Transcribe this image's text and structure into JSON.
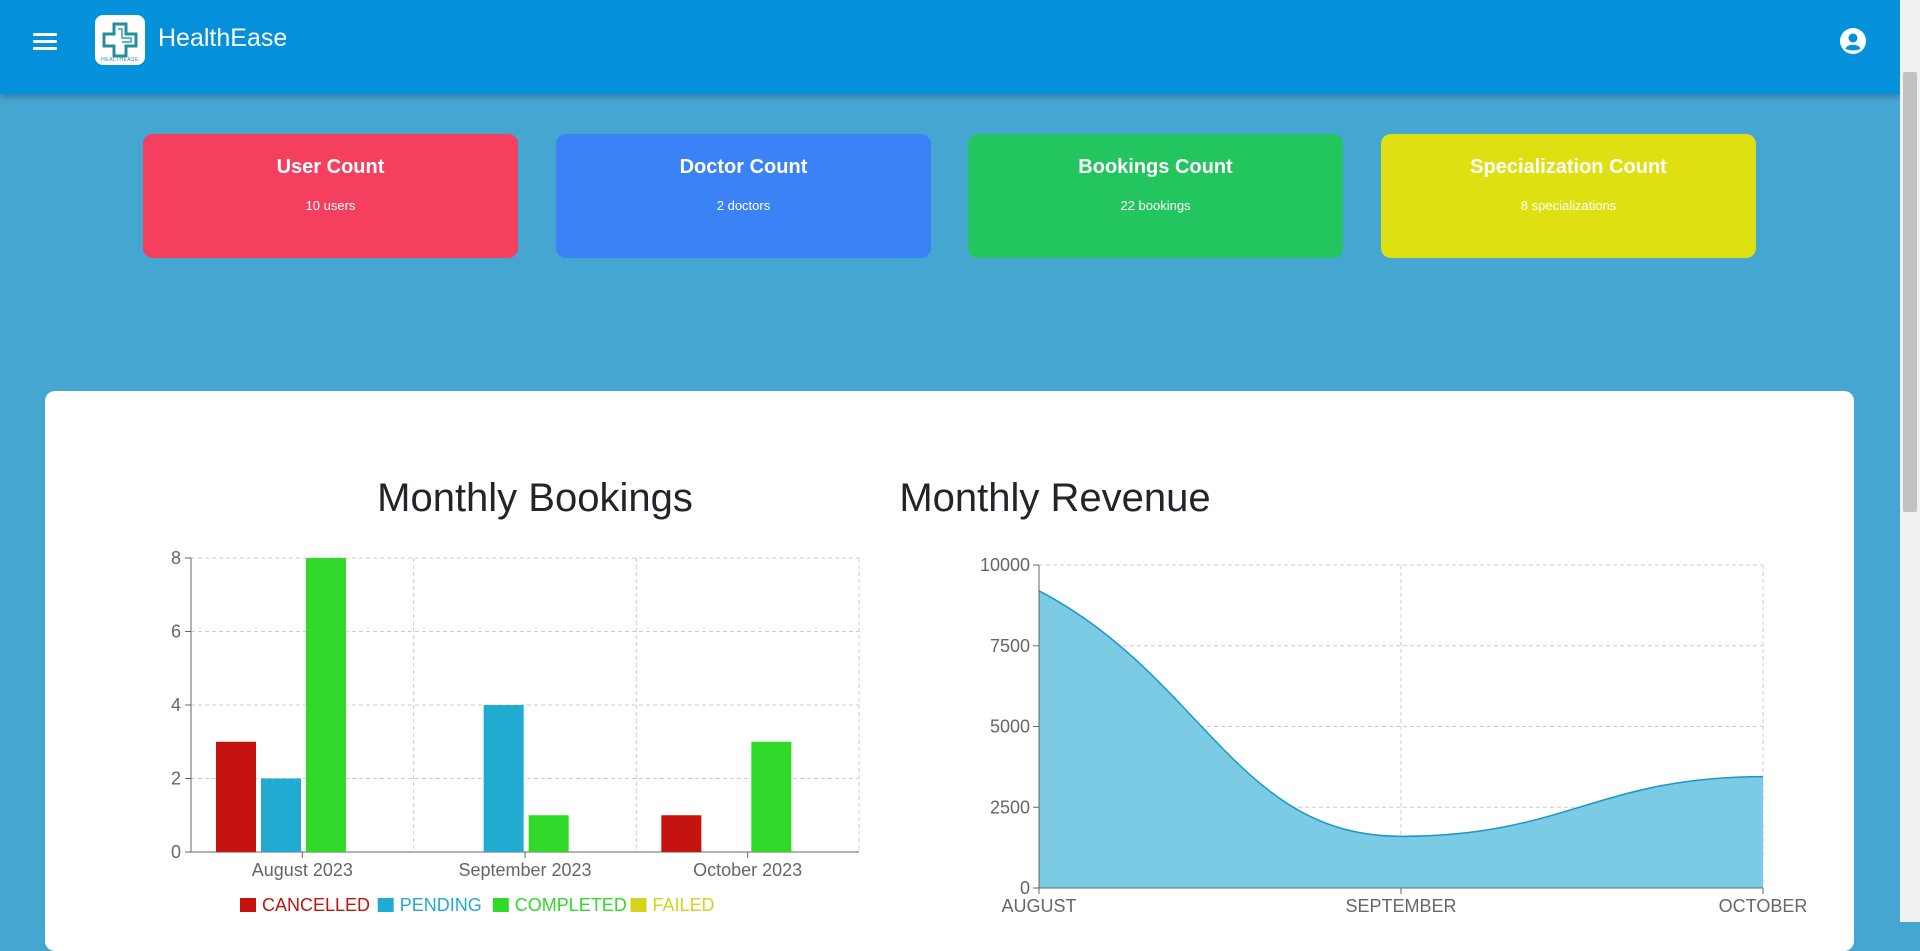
{
  "app": {
    "title": "HealthEase",
    "logo_text": "HEALTHEASE"
  },
  "stats": [
    {
      "title": "User Count",
      "value": "10 users",
      "color": "#f43f5e"
    },
    {
      "title": "Doctor Count",
      "value": "2 doctors",
      "color": "#3b82f6"
    },
    {
      "title": "Bookings Count",
      "value": "22 bookings",
      "color": "#22c55e"
    },
    {
      "title": "Specialization Count",
      "value": "8 specializations",
      "color": "#dfe012"
    }
  ],
  "charts": {
    "bookings_title": "Monthly Bookings",
    "revenue_title": "Monthly Revenue"
  },
  "chart_data": [
    {
      "type": "bar",
      "title": "Monthly Bookings",
      "categories": [
        "August 2023",
        "September 2023",
        "October 2023"
      ],
      "ylim": [
        0,
        8
      ],
      "yticks": [
        0,
        2,
        4,
        6,
        8
      ],
      "grid": true,
      "legend": "bottom",
      "series": [
        {
          "name": "CANCELLED",
          "color": "#c4120e",
          "values": [
            3,
            0,
            1
          ]
        },
        {
          "name": "PENDING",
          "color": "#22abd0",
          "values": [
            2,
            4,
            0
          ]
        },
        {
          "name": "COMPLETED",
          "color": "#31d92b",
          "values": [
            8,
            1,
            3
          ]
        },
        {
          "name": "FAILED",
          "color": "#d4d41a",
          "values": [
            0,
            0,
            0
          ]
        }
      ]
    },
    {
      "type": "area",
      "title": "Monthly Revenue",
      "x": [
        "AUGUST",
        "SEPTEMBER",
        "OCTOBER"
      ],
      "values": [
        9200,
        1600,
        3450
      ],
      "ylim": [
        0,
        10000
      ],
      "yticks": [
        0,
        2500,
        5000,
        7500,
        10000
      ],
      "grid": true,
      "color": "#7acbe3",
      "line_color": "#1a97c6"
    }
  ]
}
